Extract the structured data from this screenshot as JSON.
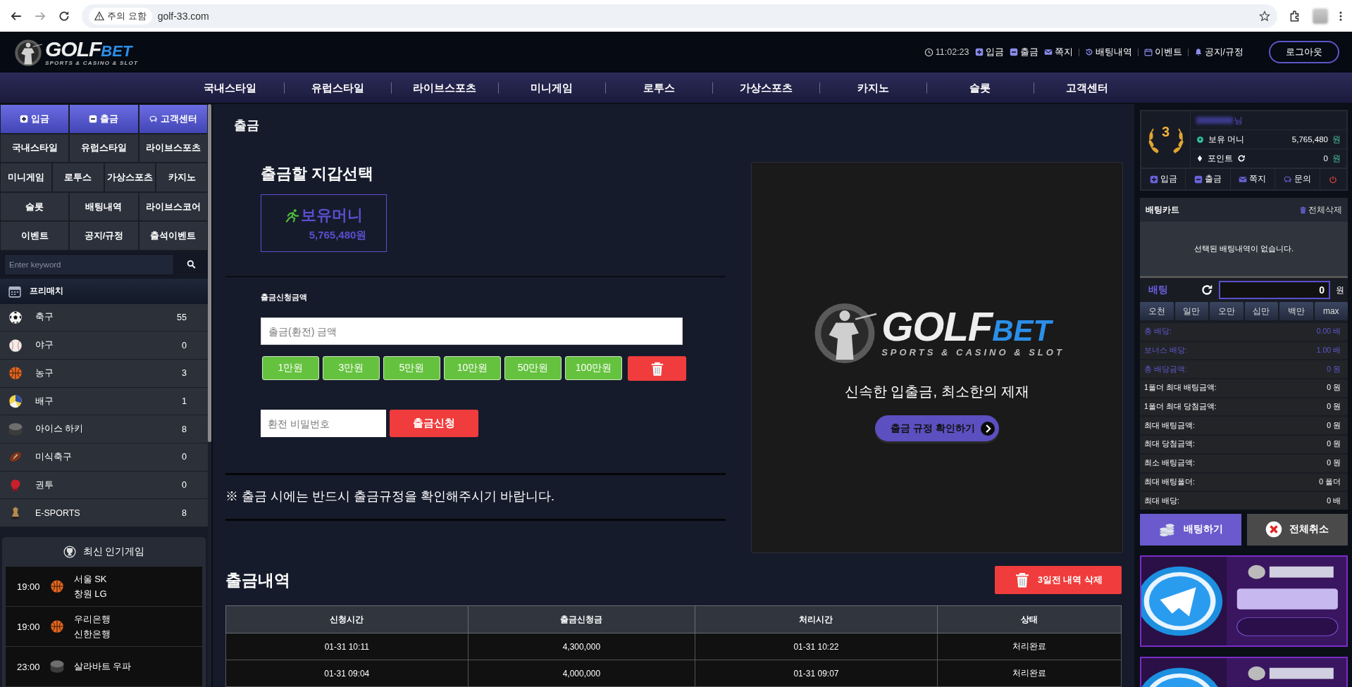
{
  "browser": {
    "warning": "주의 요함",
    "url": "golf-33.com"
  },
  "header": {
    "logo": {
      "word1": "GOLF",
      "word2": "BET",
      "tagline": "SPORTS & CASINO & SLOT"
    },
    "clock": "11:02:23",
    "links": [
      {
        "label": "입금",
        "kind": "plus"
      },
      {
        "label": "출금",
        "kind": "minus"
      },
      {
        "label": "쪽지",
        "kind": "mail"
      },
      {
        "label": "배팅내역",
        "kind": "history"
      },
      {
        "label": "이벤트",
        "kind": "calendar"
      },
      {
        "label": "공지/규정",
        "kind": "bell"
      }
    ],
    "logout": "로그아웃"
  },
  "nav": [
    "국내스타일",
    "유럽스타일",
    "라이브스포츠",
    "미니게임",
    "로투스",
    "가상스포츠",
    "카지노",
    "슬롯",
    "고객센터"
  ],
  "sidebar": {
    "button_rows": [
      [
        {
          "label": "입금",
          "kind": "deposit"
        },
        {
          "label": "출금",
          "kind": "withdraw"
        },
        {
          "label": "고객센터",
          "kind": "support"
        }
      ],
      [
        {
          "label": "국내스타일",
          "kind": "plain"
        },
        {
          "label": "유럽스타일",
          "kind": "plain"
        },
        {
          "label": "라이브스포츠",
          "kind": "plain"
        }
      ],
      [
        {
          "label": "미니게임",
          "kind": "plain"
        },
        {
          "label": "로투스",
          "kind": "plain"
        },
        {
          "label": "가상스포츠",
          "kind": "plain"
        },
        {
          "label": "카지노",
          "kind": "plain"
        }
      ],
      [
        {
          "label": "슬롯",
          "kind": "plain"
        },
        {
          "label": "배팅내역",
          "kind": "plain"
        },
        {
          "label": "라이브스코어",
          "kind": "plain"
        }
      ],
      [
        {
          "label": "이벤트",
          "kind": "plain"
        },
        {
          "label": "공지/규정",
          "kind": "plain"
        },
        {
          "label": "출석이벤트",
          "kind": "plain"
        }
      ]
    ],
    "search": {
      "placeholder": "Enter keyword"
    },
    "prematch": {
      "title": "프리매치",
      "sports": [
        {
          "name": "축구",
          "count": "55",
          "kind": "soccer"
        },
        {
          "name": "야구",
          "count": "0",
          "kind": "baseball"
        },
        {
          "name": "농구",
          "count": "3",
          "kind": "basketball"
        },
        {
          "name": "배구",
          "count": "1",
          "kind": "volleyball"
        },
        {
          "name": "아이스 하키",
          "count": "8",
          "kind": "hockey"
        },
        {
          "name": "미식축구",
          "count": "0",
          "kind": "football"
        },
        {
          "name": "권투",
          "count": "0",
          "kind": "boxing"
        },
        {
          "name": "E-SPORTS",
          "count": "8",
          "kind": "esports"
        }
      ]
    },
    "popular": {
      "title": "최신 인기게임",
      "games": [
        {
          "time": "19:00",
          "kind": "basketball",
          "home": "서울 SK",
          "away": "창원 LG"
        },
        {
          "time": "19:00",
          "kind": "basketball",
          "home": "우리은행",
          "away": "신한은행"
        },
        {
          "time": "23:00",
          "kind": "hockey",
          "home": "살라바트 우파"
        }
      ]
    }
  },
  "main": {
    "title": "출금",
    "wallet_title": "출금할 지갑선택",
    "wallet": {
      "name": "보유머니",
      "amount": "5,765,480원"
    },
    "amount_label": "출금신청금액",
    "amount_placeholder": "출금(환전) 금액",
    "quick_amounts": [
      "1만원",
      "3만원",
      "5만원",
      "10만원",
      "50만원",
      "100만원"
    ],
    "password_placeholder": "환전 비밀번호",
    "submit": "출금신청",
    "notice": "※ 출금 시에는 반드시 출금규정을 확인해주시기 바랍니다.",
    "promo": {
      "logo": {
        "word1": "GOLF",
        "word2": "BET",
        "tagline": "SPORTS & CASINO & SLOT"
      },
      "slogan": "신속한 입출금, 최소한의 제재",
      "button": "출금 규정 확인하기"
    },
    "history": {
      "title": "출금내역",
      "delete_button": "3일전 내역 삭제",
      "columns": [
        "신청시간",
        "출금신청금",
        "처리시간",
        "상태"
      ],
      "rows": [
        [
          "01-31 10:11",
          "4,300,000",
          "01-31 10:22",
          "처리완료"
        ],
        [
          "01-31 09:04",
          "4,000,000",
          "01-31 09:07",
          "처리완료"
        ]
      ]
    }
  },
  "right": {
    "user": {
      "level": "3",
      "name_suffix": "님",
      "money_label": "보유 머니",
      "money": "5,765,480",
      "money_unit": "원",
      "point_label": "포인트",
      "points": "0",
      "points_unit": "원",
      "actions": [
        {
          "label": "입금",
          "kind": "plus"
        },
        {
          "label": "출금",
          "kind": "minus"
        },
        {
          "label": "쪽지",
          "kind": "mail"
        },
        {
          "label": "문의",
          "kind": "chat"
        },
        {
          "kind": "power"
        }
      ]
    },
    "bet_cart": {
      "title": "배팅카트",
      "clear": "전체삭제",
      "empty": "선택된 배팅내역이 없습니다.",
      "bet_label": "배팅",
      "amount": "0",
      "unit": "원",
      "chips": [
        "오천",
        "일만",
        "오만",
        "십만",
        "백만",
        "max"
      ],
      "stats": [
        {
          "label": "총 배당:",
          "value": "0.00 배",
          "highlighted": true
        },
        {
          "label": "보너스 배당:",
          "value": "1.00 배",
          "highlighted": true
        },
        {
          "label": "총 배당금액:",
          "value": "0 원",
          "highlighted": true
        },
        {
          "label": "1폴더 최대 배팅금액:",
          "value": "0 원",
          "highlighted": false
        },
        {
          "label": "1폴더 최대 당첨금액:",
          "value": "0 원",
          "highlighted": false
        },
        {
          "label": "최대 배팅금액:",
          "value": "0 원",
          "highlighted": false
        },
        {
          "label": "최대 당첨금액:",
          "value": "0 원",
          "highlighted": false
        },
        {
          "label": "최소 배팅금액:",
          "value": "0 원",
          "highlighted": false
        },
        {
          "label": "최대 배팅폴더:",
          "value": "0 폴더",
          "highlighted": false
        },
        {
          "label": "최대 배당:",
          "value": "0 배",
          "highlighted": false
        }
      ],
      "submit": "배팅하기",
      "cancel": "전체취소"
    }
  }
}
